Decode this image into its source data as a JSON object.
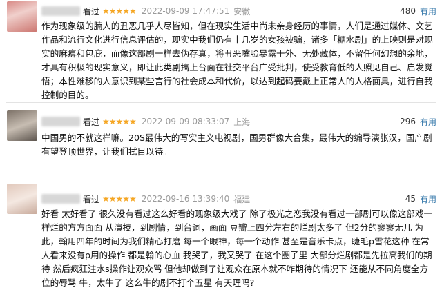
{
  "reviews": [
    {
      "status": "看过",
      "stars": "★★★★★",
      "time": "2022-09-09 17:47:51",
      "location": "安徽",
      "votes": "480",
      "useful_label": "有用",
      "content": "作为现象级的腩人的丑恶几乎人尽皆知，但在现实生活中尚未亲身经历的事情，人们是通过媒体、文艺作品和流行文化进行信息评估的，现实中我们仍有十几岁的女孩被骗，诸多「糖水剧」的上映则是对现实的麻痹和包庇，而像这部剧一样去伪存真，将丑恶嘴脸暴露于外、无处藏体，不留任何幻想的余地，才具有积极的现实意义，即让此类剧搞上台面在社交平台广受批判，使受教育低的人照见自己、启发觉悟；本性难移的人意识到某些言行的社会成本和代价，以达到起码要戴上正常人的人格面具，进行自我控制的目的。"
    },
    {
      "status": "看过",
      "stars": "★★★★★",
      "time": "2022-09-09 08:33:07",
      "location": "上海",
      "votes": "296",
      "useful_label": "有用",
      "content": "中国男的不就这样嘛。20S最伟大的写实主义电视剧，国男群像大合集，最伟大的编导演张汉，国产剧有望登顶世界，让我们拭目以待。"
    },
    {
      "status": "看过",
      "stars": "★★★★★",
      "time": "2022-09-16 13:39:40",
      "location": "福建",
      "votes": "45",
      "useful_label": "有用",
      "content": "好看 太好看了 很久没有看过这么好看的现象级大戏了 除了极光之恋我没有看过一部剧可以像这部戏一样烂的方方面面 从演技，到剧情，到台词，画面 豆瓣上四分左右的烂剧太多了 但2分的寥寥无几 为此，翰用四年的时间为我们精心打磨 每一个眼神，每一个动作 甚至是音乐卡点，睫毛p雪花这种 在常人看来没有p用的操作 都是翰的心血 我哭了，我又哭了 在这个圈子里 大部分烂剧都是先拉高我们的期待 然后疯狂注水s操作让观众骂 但他却做到了让观众在原本就不咋期待的情况下 还能从不同角度全方位的辱骂 牛，太牛了 这么牛的剧不打个五星 有天理吗?"
    }
  ]
}
